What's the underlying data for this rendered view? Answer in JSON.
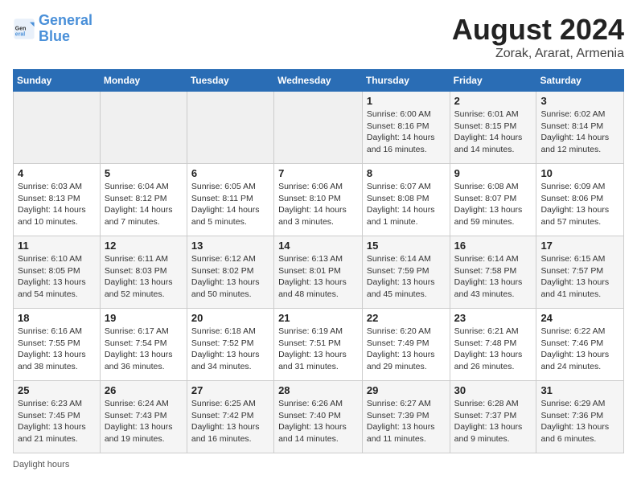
{
  "logo": {
    "text_general": "General",
    "text_blue": "Blue"
  },
  "title": "August 2024",
  "subtitle": "Zorak, Ararat, Armenia",
  "days_of_week": [
    "Sunday",
    "Monday",
    "Tuesday",
    "Wednesday",
    "Thursday",
    "Friday",
    "Saturday"
  ],
  "footer": {
    "daylight_hours": "Daylight hours"
  },
  "weeks": [
    {
      "days": [
        {
          "num": "",
          "info": ""
        },
        {
          "num": "",
          "info": ""
        },
        {
          "num": "",
          "info": ""
        },
        {
          "num": "",
          "info": ""
        },
        {
          "num": "1",
          "info": "Sunrise: 6:00 AM\nSunset: 8:16 PM\nDaylight: 14 hours and 16 minutes."
        },
        {
          "num": "2",
          "info": "Sunrise: 6:01 AM\nSunset: 8:15 PM\nDaylight: 14 hours and 14 minutes."
        },
        {
          "num": "3",
          "info": "Sunrise: 6:02 AM\nSunset: 8:14 PM\nDaylight: 14 hours and 12 minutes."
        }
      ]
    },
    {
      "days": [
        {
          "num": "4",
          "info": "Sunrise: 6:03 AM\nSunset: 8:13 PM\nDaylight: 14 hours and 10 minutes."
        },
        {
          "num": "5",
          "info": "Sunrise: 6:04 AM\nSunset: 8:12 PM\nDaylight: 14 hours and 7 minutes."
        },
        {
          "num": "6",
          "info": "Sunrise: 6:05 AM\nSunset: 8:11 PM\nDaylight: 14 hours and 5 minutes."
        },
        {
          "num": "7",
          "info": "Sunrise: 6:06 AM\nSunset: 8:10 PM\nDaylight: 14 hours and 3 minutes."
        },
        {
          "num": "8",
          "info": "Sunrise: 6:07 AM\nSunset: 8:08 PM\nDaylight: 14 hours and 1 minute."
        },
        {
          "num": "9",
          "info": "Sunrise: 6:08 AM\nSunset: 8:07 PM\nDaylight: 13 hours and 59 minutes."
        },
        {
          "num": "10",
          "info": "Sunrise: 6:09 AM\nSunset: 8:06 PM\nDaylight: 13 hours and 57 minutes."
        }
      ]
    },
    {
      "days": [
        {
          "num": "11",
          "info": "Sunrise: 6:10 AM\nSunset: 8:05 PM\nDaylight: 13 hours and 54 minutes."
        },
        {
          "num": "12",
          "info": "Sunrise: 6:11 AM\nSunset: 8:03 PM\nDaylight: 13 hours and 52 minutes."
        },
        {
          "num": "13",
          "info": "Sunrise: 6:12 AM\nSunset: 8:02 PM\nDaylight: 13 hours and 50 minutes."
        },
        {
          "num": "14",
          "info": "Sunrise: 6:13 AM\nSunset: 8:01 PM\nDaylight: 13 hours and 48 minutes."
        },
        {
          "num": "15",
          "info": "Sunrise: 6:14 AM\nSunset: 7:59 PM\nDaylight: 13 hours and 45 minutes."
        },
        {
          "num": "16",
          "info": "Sunrise: 6:14 AM\nSunset: 7:58 PM\nDaylight: 13 hours and 43 minutes."
        },
        {
          "num": "17",
          "info": "Sunrise: 6:15 AM\nSunset: 7:57 PM\nDaylight: 13 hours and 41 minutes."
        }
      ]
    },
    {
      "days": [
        {
          "num": "18",
          "info": "Sunrise: 6:16 AM\nSunset: 7:55 PM\nDaylight: 13 hours and 38 minutes."
        },
        {
          "num": "19",
          "info": "Sunrise: 6:17 AM\nSunset: 7:54 PM\nDaylight: 13 hours and 36 minutes."
        },
        {
          "num": "20",
          "info": "Sunrise: 6:18 AM\nSunset: 7:52 PM\nDaylight: 13 hours and 34 minutes."
        },
        {
          "num": "21",
          "info": "Sunrise: 6:19 AM\nSunset: 7:51 PM\nDaylight: 13 hours and 31 minutes."
        },
        {
          "num": "22",
          "info": "Sunrise: 6:20 AM\nSunset: 7:49 PM\nDaylight: 13 hours and 29 minutes."
        },
        {
          "num": "23",
          "info": "Sunrise: 6:21 AM\nSunset: 7:48 PM\nDaylight: 13 hours and 26 minutes."
        },
        {
          "num": "24",
          "info": "Sunrise: 6:22 AM\nSunset: 7:46 PM\nDaylight: 13 hours and 24 minutes."
        }
      ]
    },
    {
      "days": [
        {
          "num": "25",
          "info": "Sunrise: 6:23 AM\nSunset: 7:45 PM\nDaylight: 13 hours and 21 minutes."
        },
        {
          "num": "26",
          "info": "Sunrise: 6:24 AM\nSunset: 7:43 PM\nDaylight: 13 hours and 19 minutes."
        },
        {
          "num": "27",
          "info": "Sunrise: 6:25 AM\nSunset: 7:42 PM\nDaylight: 13 hours and 16 minutes."
        },
        {
          "num": "28",
          "info": "Sunrise: 6:26 AM\nSunset: 7:40 PM\nDaylight: 13 hours and 14 minutes."
        },
        {
          "num": "29",
          "info": "Sunrise: 6:27 AM\nSunset: 7:39 PM\nDaylight: 13 hours and 11 minutes."
        },
        {
          "num": "30",
          "info": "Sunrise: 6:28 AM\nSunset: 7:37 PM\nDaylight: 13 hours and 9 minutes."
        },
        {
          "num": "31",
          "info": "Sunrise: 6:29 AM\nSunset: 7:36 PM\nDaylight: 13 hours and 6 minutes."
        }
      ]
    }
  ]
}
